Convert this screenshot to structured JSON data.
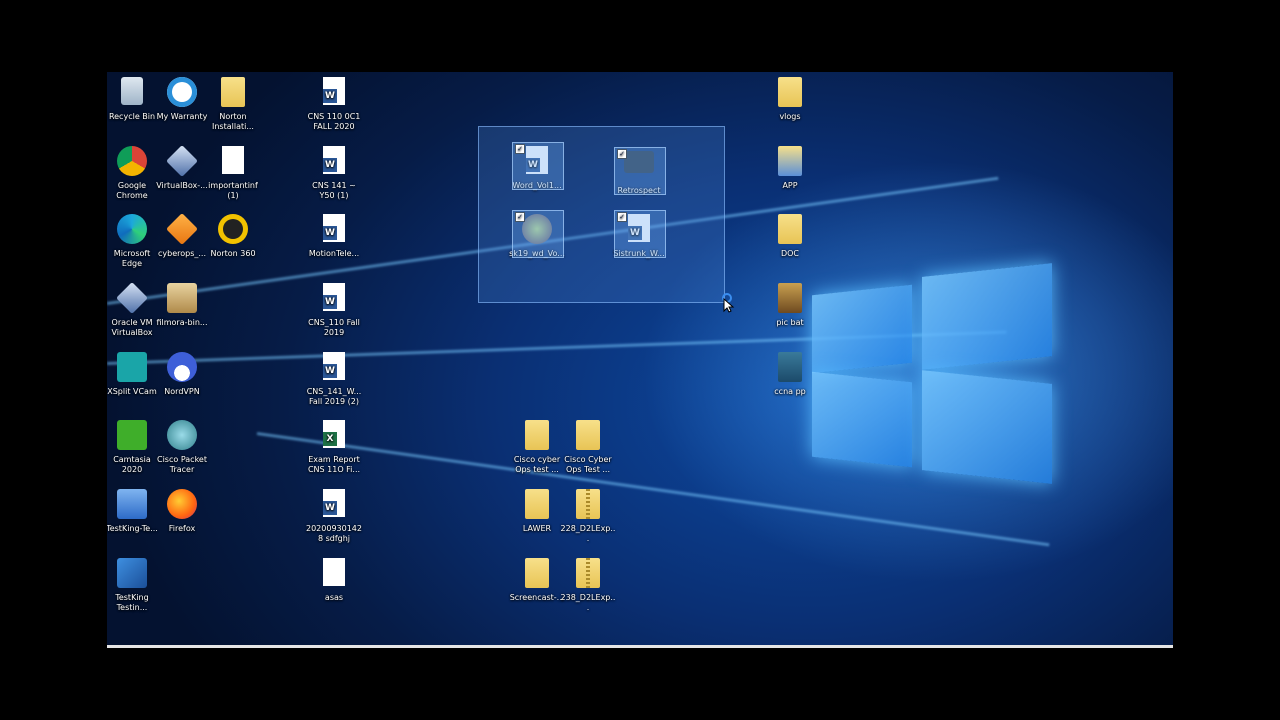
{
  "desktop": {
    "icons": [
      {
        "label": "Recycle Bin",
        "icon": "recycle-bin-icon"
      },
      {
        "label": "My Warranty",
        "icon": "my-warranty-icon"
      },
      {
        "label": "Norton Installati...",
        "icon": "norton-installer-icon"
      },
      {
        "label": "CNS 110 0C1 FALL 2020",
        "icon": "word-document-icon"
      },
      {
        "label": "Google Chrome",
        "icon": "chrome-icon"
      },
      {
        "label": "VirtualBox-...",
        "icon": "virtualbox-icon"
      },
      {
        "label": "importantinf (1)",
        "icon": "text-file-icon"
      },
      {
        "label": "CNS 141 ~ Y50 (1)",
        "icon": "word-document-icon"
      },
      {
        "label": "Microsoft Edge",
        "icon": "edge-icon"
      },
      {
        "label": "cyberops_...",
        "icon": "cyberops-icon"
      },
      {
        "label": "Norton 360",
        "icon": "norton-360-icon"
      },
      {
        "label": "MotionTele...",
        "icon": "word-document-icon"
      },
      {
        "label": "Oracle VM VirtualBox",
        "icon": "virtualbox-icon"
      },
      {
        "label": "filmora-bin...",
        "icon": "filmora-icon"
      },
      {
        "label": "CNS_110 Fall 2019",
        "icon": "word-document-icon"
      },
      {
        "label": "XSplit VCam",
        "icon": "xsplit-icon"
      },
      {
        "label": "NordVPN",
        "icon": "nordvpn-icon"
      },
      {
        "label": "CNS_141_W... Fall 2019 (2)",
        "icon": "word-document-icon"
      },
      {
        "label": "Camtasia 2020",
        "icon": "camtasia-icon"
      },
      {
        "label": "Cisco Packet Tracer",
        "icon": "packet-tracer-icon"
      },
      {
        "label": "Exam Report CNS 11O Fi...",
        "icon": "excel-document-icon"
      },
      {
        "label": "TestKing-Te...",
        "icon": "testking-icon"
      },
      {
        "label": "Firefox",
        "icon": "firefox-icon"
      },
      {
        "label": "202009301428 sdfghj",
        "icon": "word-document-icon"
      },
      {
        "label": "TestKing Testin...",
        "icon": "testking-icon"
      },
      {
        "label": "asas",
        "icon": "text-file-icon"
      },
      {
        "label": "Word_Vol1...",
        "icon": "word-document-icon"
      },
      {
        "label": "Retrospect",
        "icon": "retrospect-icon"
      },
      {
        "label": "sk19_wd_Vo...",
        "icon": "image-file-icon"
      },
      {
        "label": "Sistrunk_W...",
        "icon": "word-document-icon"
      },
      {
        "label": "Cisco cyber Ops test ...",
        "icon": "folder-icon"
      },
      {
        "label": "Cisco Cyber Ops Test ...",
        "icon": "folder-icon"
      },
      {
        "label": "LAWER",
        "icon": "folder-icon"
      },
      {
        "label": "228_D2LExp...",
        "icon": "zip-folder-icon"
      },
      {
        "label": "Screencast-...",
        "icon": "folder-icon"
      },
      {
        "label": "238_D2LExp...",
        "icon": "zip-folder-icon"
      },
      {
        "label": "vlogs",
        "icon": "folder-icon"
      },
      {
        "label": "APP",
        "icon": "folder-icon"
      },
      {
        "label": "DOC",
        "icon": "folder-icon"
      },
      {
        "label": "pic bat",
        "icon": "folder-icon"
      },
      {
        "label": "ccna pp",
        "icon": "folder-icon"
      }
    ]
  },
  "colors": {
    "accent": "#2b5797",
    "excel": "#1e7145",
    "folder": "#e8c455"
  }
}
